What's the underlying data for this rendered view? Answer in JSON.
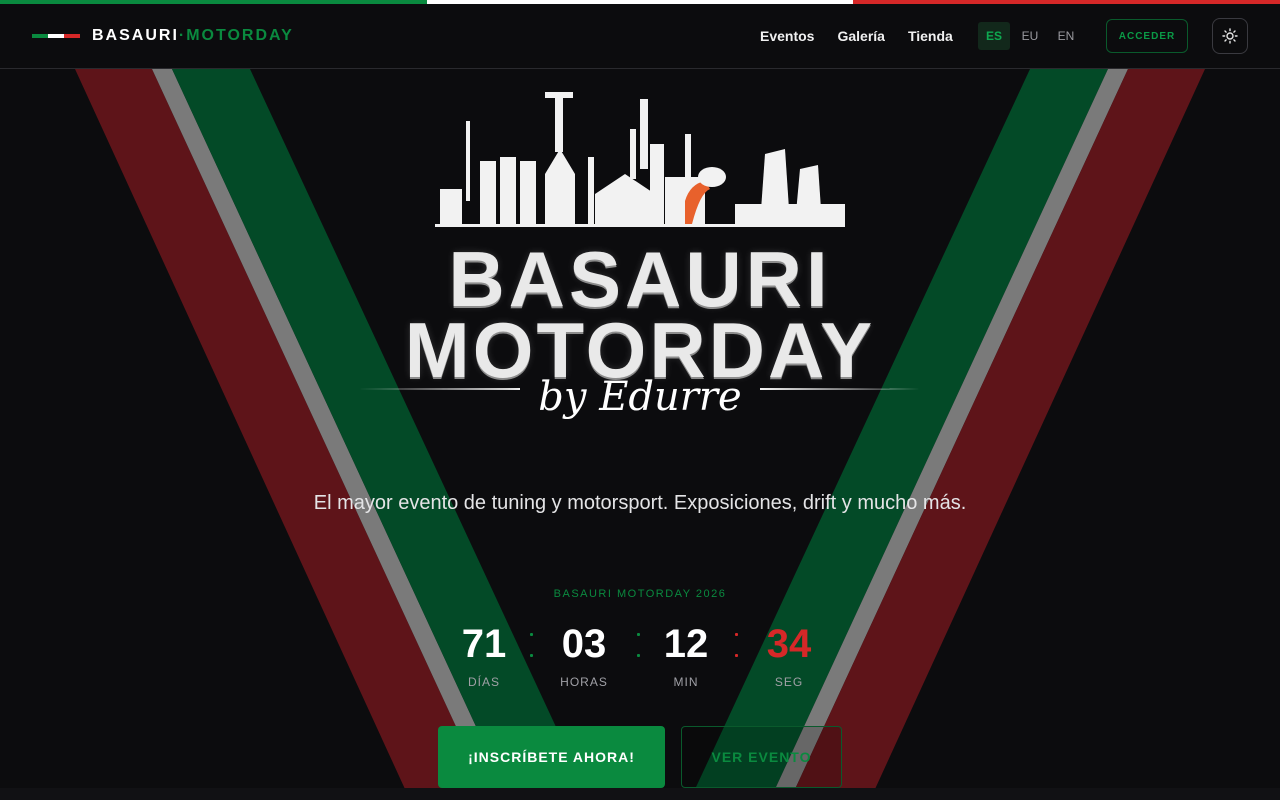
{
  "colors": {
    "green": "#0a8a3f",
    "white": "#ffffff",
    "red": "#d62828",
    "background": "#0c0c0e"
  },
  "brand": {
    "part1": "BASAURI",
    "separator": "·",
    "part2": "MOTORDAY"
  },
  "nav": {
    "items": [
      {
        "label": "Eventos"
      },
      {
        "label": "Galería"
      },
      {
        "label": "Tienda"
      }
    ]
  },
  "languages": {
    "items": [
      {
        "code": "ES",
        "active": true
      },
      {
        "code": "EU",
        "active": false
      },
      {
        "code": "EN",
        "active": false
      }
    ]
  },
  "header": {
    "login_label": "ACCEDER",
    "theme_icon": "sun-icon"
  },
  "hero": {
    "logo": {
      "line1": "BASAURI",
      "line2": "MOTORDAY",
      "signature": "by Edurre",
      "skyline_icon": "industrial-skyline-icon"
    },
    "tagline": "El mayor evento de tuning y motorsport. Exposiciones, drift y mucho más.",
    "event_label": "BASAURI MOTORDAY 2026",
    "countdown": {
      "days": {
        "value": "71",
        "label": "DÍAS"
      },
      "hours": {
        "value": "03",
        "label": "HORAS"
      },
      "minutes": {
        "value": "12",
        "label": "MIN"
      },
      "seconds": {
        "value": "34",
        "label": "SEG"
      }
    },
    "primary_cta": "¡INSCRÍBETE AHORA!",
    "secondary_cta": "VER EVENTO"
  }
}
